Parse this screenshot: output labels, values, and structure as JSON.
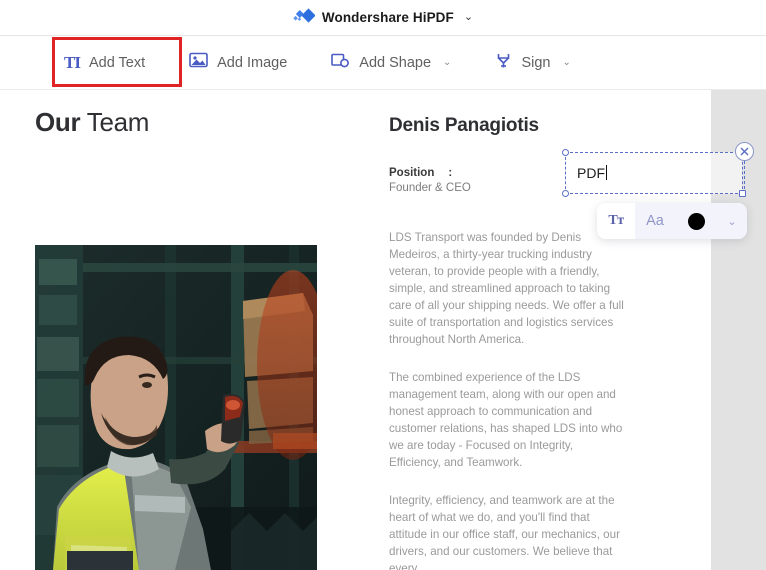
{
  "titlebar": {
    "app_name": "Wondershare HiPDF",
    "caret": "⌄",
    "logo_icon": "wondershare-diamond-logo"
  },
  "toolbar": {
    "items": [
      {
        "id": "add-text",
        "label": "Add Text",
        "icon": "text-icon",
        "glyph": "TI",
        "has_caret": false,
        "highlighted": true
      },
      {
        "id": "add-image",
        "label": "Add Image",
        "icon": "image-icon",
        "glyph": "",
        "has_caret": false,
        "highlighted": false
      },
      {
        "id": "add-shape",
        "label": "Add Shape",
        "icon": "shape-icon",
        "glyph": "",
        "has_caret": true,
        "highlighted": false
      },
      {
        "id": "sign",
        "label": "Sign",
        "icon": "sign-pen-icon",
        "glyph": "",
        "has_caret": true,
        "highlighted": false
      }
    ],
    "caret": "⌄",
    "highlight_color": "#e02424",
    "icon_color": "#4a5bc4",
    "label_color": "#606060"
  },
  "document": {
    "title_bold": "Our",
    "title_light": " Team",
    "photo_alt": "warehouse-worker-photo",
    "bio": {
      "name": "Denis Panagiotis",
      "position_label": "Position",
      "position_colon": ":",
      "position_value": "Founder & CEO",
      "paragraphs": [
        "LDS Transport was founded by Denis Medeiros, a thirty-year trucking industry veteran, to provide people with a friendly, simple, and streamlined approach to taking care of all your shipping needs. We offer a full suite of transportation and logistics services throughout North America.",
        "The combined experience of the LDS management team, along with our open and honest approach to communication and customer relations, has shaped LDS into who we are today - Focused on Integrity, Efficiency, and Teamwork.",
        "Integrity, efficiency, and teamwork are at the heart of what we do, and you'll find that attitude in our office staff, our mechanics, our drivers, and our customers. We believe that every"
      ]
    }
  },
  "text_edit_overlay": {
    "value": "PDF",
    "close_icon": "close-icon",
    "border_color": "#5b6fc4",
    "format_bar": {
      "font_button_glyph": "Tт",
      "size_button_glyph": "Aa",
      "color_value": "#000000",
      "more_caret": "⌄"
    }
  }
}
